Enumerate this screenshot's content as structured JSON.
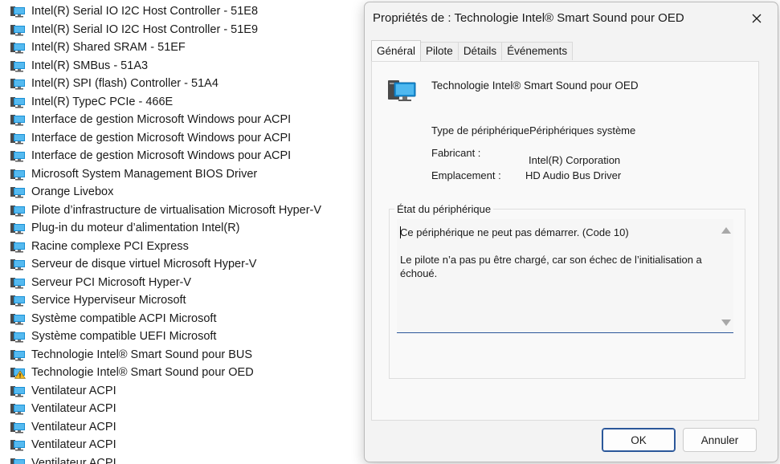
{
  "device_list": {
    "items": [
      {
        "label": "Intel(R) Serial IO I2C Host Controller - 51E8",
        "icon": "device-icon"
      },
      {
        "label": "Intel(R) Serial IO I2C Host Controller - 51E9",
        "icon": "device-icon"
      },
      {
        "label": "Intel(R) Shared SRAM - 51EF",
        "icon": "device-icon"
      },
      {
        "label": "Intel(R) SMBus - 51A3",
        "icon": "device-icon"
      },
      {
        "label": "Intel(R) SPI (flash) Controller - 51A4",
        "icon": "device-icon"
      },
      {
        "label": "Intel(R) TypeC PCIe - 466E",
        "icon": "device-icon"
      },
      {
        "label": "Interface de gestion Microsoft Windows pour ACPI",
        "icon": "device-icon"
      },
      {
        "label": "Interface de gestion Microsoft Windows pour ACPI",
        "icon": "device-icon"
      },
      {
        "label": "Interface de gestion Microsoft Windows pour ACPI",
        "icon": "device-icon"
      },
      {
        "label": "Microsoft System Management BIOS Driver",
        "icon": "device-icon"
      },
      {
        "label": "Orange Livebox",
        "icon": "device-icon"
      },
      {
        "label": "Pilote d’infrastructure de virtualisation Microsoft Hyper-V",
        "icon": "device-icon"
      },
      {
        "label": "Plug-in du moteur d’alimentation Intel(R)",
        "icon": "device-icon"
      },
      {
        "label": "Racine complexe PCI Express",
        "icon": "device-icon"
      },
      {
        "label": "Serveur de disque virtuel Microsoft Hyper-V",
        "icon": "device-icon"
      },
      {
        "label": "Serveur PCI Microsoft Hyper-V",
        "icon": "device-icon"
      },
      {
        "label": "Service Hyperviseur Microsoft",
        "icon": "device-icon"
      },
      {
        "label": "Système compatible ACPI Microsoft",
        "icon": "device-icon"
      },
      {
        "label": "Système compatible UEFI Microsoft",
        "icon": "device-icon"
      },
      {
        "label": "Technologie Intel® Smart Sound pour BUS",
        "icon": "device-icon"
      },
      {
        "label": "Technologie Intel® Smart Sound pour OED",
        "icon": "warning-device-icon"
      },
      {
        "label": "Ventilateur ACPI",
        "icon": "device-icon"
      },
      {
        "label": "Ventilateur ACPI",
        "icon": "device-icon"
      },
      {
        "label": "Ventilateur ACPI",
        "icon": "device-icon"
      },
      {
        "label": "Ventilateur ACPI",
        "icon": "device-icon"
      },
      {
        "label": "Ventilateur ACPI",
        "icon": "device-icon"
      }
    ]
  },
  "dialog": {
    "title": "Propriétés de : Technologie Intel® Smart Sound pour OED",
    "tabs": [
      {
        "label": "Général",
        "active": true
      },
      {
        "label": "Pilote",
        "active": false
      },
      {
        "label": "Détails",
        "active": false
      },
      {
        "label": "Événements",
        "active": false
      }
    ],
    "device_name": "Technologie Intel® Smart Sound pour OED",
    "properties": {
      "type_label": "Type de périphérique",
      "type_value": "Périphériques système",
      "manufacturer_label": "Fabricant :",
      "manufacturer_value": "Intel(R) Corporation",
      "location_label": "Emplacement :",
      "location_value": "HD Audio Bus Driver"
    },
    "status": {
      "legend": "État du périphérique",
      "text": "Ce périphérique ne peut pas démarrer. (Code 10)\n\nLe pilote n’a pas pu être chargé, car son échec de l’initialisation a échoué."
    },
    "buttons": {
      "ok": "OK",
      "cancel": "Annuler"
    }
  },
  "colors": {
    "accent": "#2b579a",
    "warning": "#f2b71e"
  }
}
